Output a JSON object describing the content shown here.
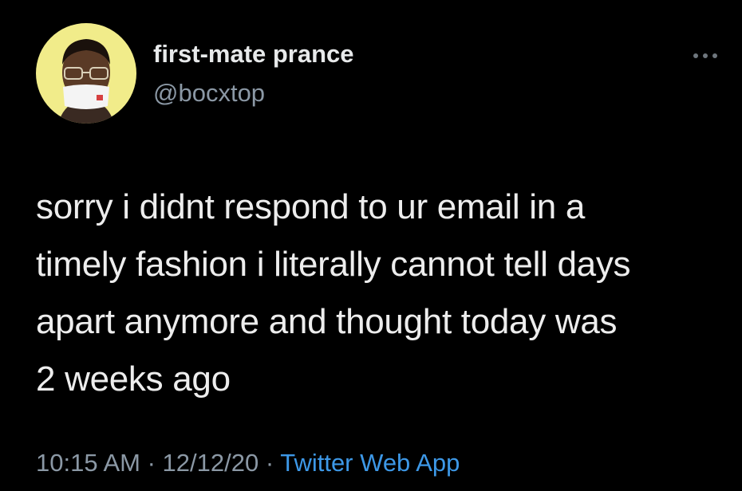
{
  "tweet": {
    "author": {
      "display_name": "first-mate prance",
      "handle": "@bocxtop",
      "avatar_icon": "profile-photo"
    },
    "more_icon": "more-options-icon",
    "text": "sorry i didnt respond to ur email in a\ntimely fashion i literally cannot tell days\napart anymore and thought today was\n2 weeks ago",
    "meta": {
      "time": "10:15 AM",
      "separator_1": " · ",
      "date": "12/12/20",
      "separator_2": " · ",
      "source": "Twitter Web App"
    }
  },
  "colors": {
    "background": "#000000",
    "name": "#e7e9ea",
    "secondary": "#8b98a5",
    "link": "#3d98e7",
    "avatar_bg": "#f1ec8a"
  }
}
